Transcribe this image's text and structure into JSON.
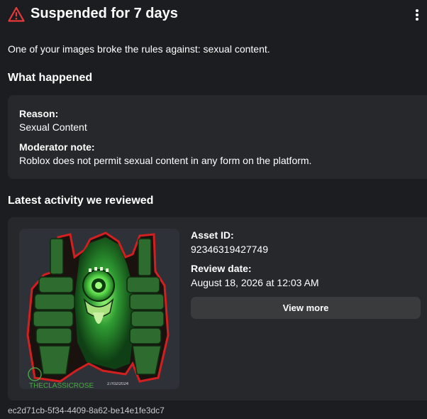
{
  "header": {
    "title": "Suspended for 7 days",
    "warning_icon": "warning-triangle-icon",
    "menu_icon": "more-vertical-icon",
    "accent_color": "#e5393a"
  },
  "summary": "One of your images broke the rules against: sexual content.",
  "what_happened": {
    "heading": "What happened",
    "reason_label": "Reason:",
    "reason_value": "Sexual Content",
    "note_label": "Moderator note:",
    "note_value": "Roblox does not permit sexual content in any form on the platform."
  },
  "activity": {
    "heading": "Latest activity we reviewed",
    "asset_id_label": "Asset ID:",
    "asset_id_value": "92346319427749",
    "review_date_label": "Review date:",
    "review_date_value": "August 18, 2026 at 12:03 AM",
    "view_more_label": "View more",
    "image": {
      "watermark": "THECLASSICROSE",
      "date_stamp": "27/02/2024"
    }
  },
  "footer": {
    "reference_id": "ec2d71cb-5f34-4409-8a62-be14e1fe3dc7"
  }
}
